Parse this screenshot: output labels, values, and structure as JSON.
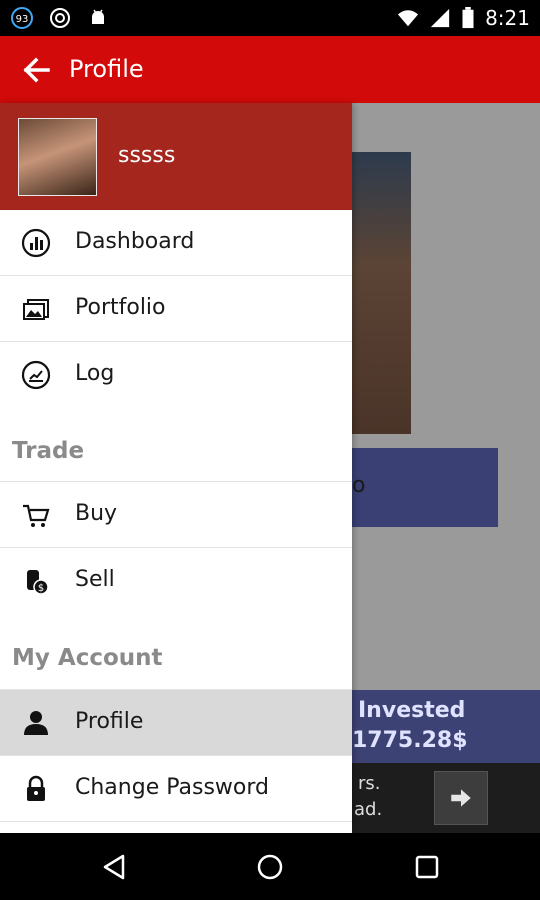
{
  "status_bar": {
    "notification_badge": "93",
    "time": "8:21"
  },
  "app_bar": {
    "title": "Profile"
  },
  "drawer": {
    "username": "sssss",
    "main_items": [
      {
        "label": "Dashboard",
        "icon": "dashboard-icon"
      },
      {
        "label": "Portfolio",
        "icon": "portfolio-icon"
      },
      {
        "label": "Log",
        "icon": "log-icon"
      }
    ],
    "trade_header": "Trade",
    "trade_items": [
      {
        "label": "Buy",
        "icon": "cart-icon"
      },
      {
        "label": "Sell",
        "icon": "coins-icon"
      }
    ],
    "account_header": "My Account",
    "account_items": [
      {
        "label": "Profile",
        "icon": "person-icon",
        "active": true
      },
      {
        "label": "Change Password",
        "icon": "lock-icon"
      }
    ]
  },
  "background": {
    "banner_text": "o",
    "invested_label": "Invested",
    "invested_value": "1775.28$",
    "ad_line1": "rs.",
    "ad_line2": "ad."
  },
  "colors": {
    "app_bar": "#d20a0a",
    "drawer_header": "#a5261d",
    "active_item": "#d9d9d9",
    "section_header": "#8a8a8a",
    "invested_bg": "#3d4275"
  }
}
